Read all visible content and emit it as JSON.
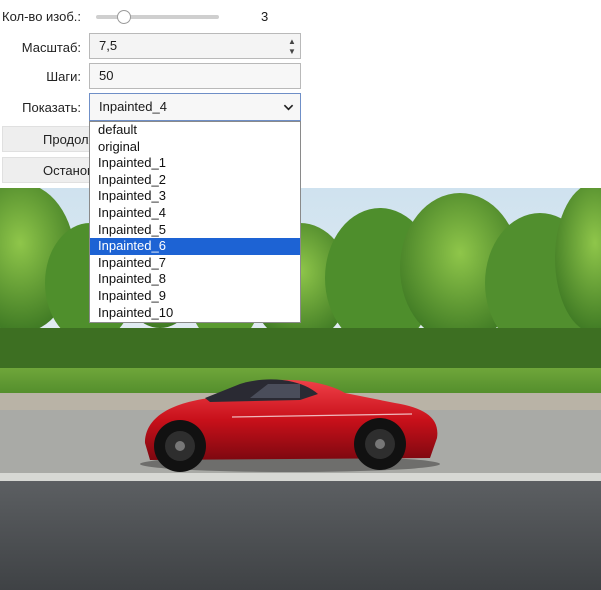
{
  "controls": {
    "count": {
      "label": "Кол-во изоб.:",
      "value": "3",
      "slider_fraction": 0.23
    },
    "scale": {
      "label": "Масштаб:",
      "value": "7,5"
    },
    "steps": {
      "label": "Шаги:",
      "value": "50"
    },
    "show": {
      "label": "Показать:",
      "selected": "Inpainted_4",
      "options": [
        "default",
        "original",
        "Inpainted_1",
        "Inpainted_2",
        "Inpainted_3",
        "Inpainted_4",
        "Inpainted_5",
        "Inpainted_6",
        "Inpainted_7",
        "Inpainted_8",
        "Inpainted_9",
        "Inpainted_10"
      ],
      "highlighted": "Inpainted_6"
    }
  },
  "buttons": {
    "continue_label": "Продолж",
    "stop_label": "Останов"
  },
  "image": {
    "alt": "Красный спортивный автомобиль на фоне деревьев"
  },
  "colors": {
    "accent": "#1d63d4",
    "car": "#c8101a"
  }
}
